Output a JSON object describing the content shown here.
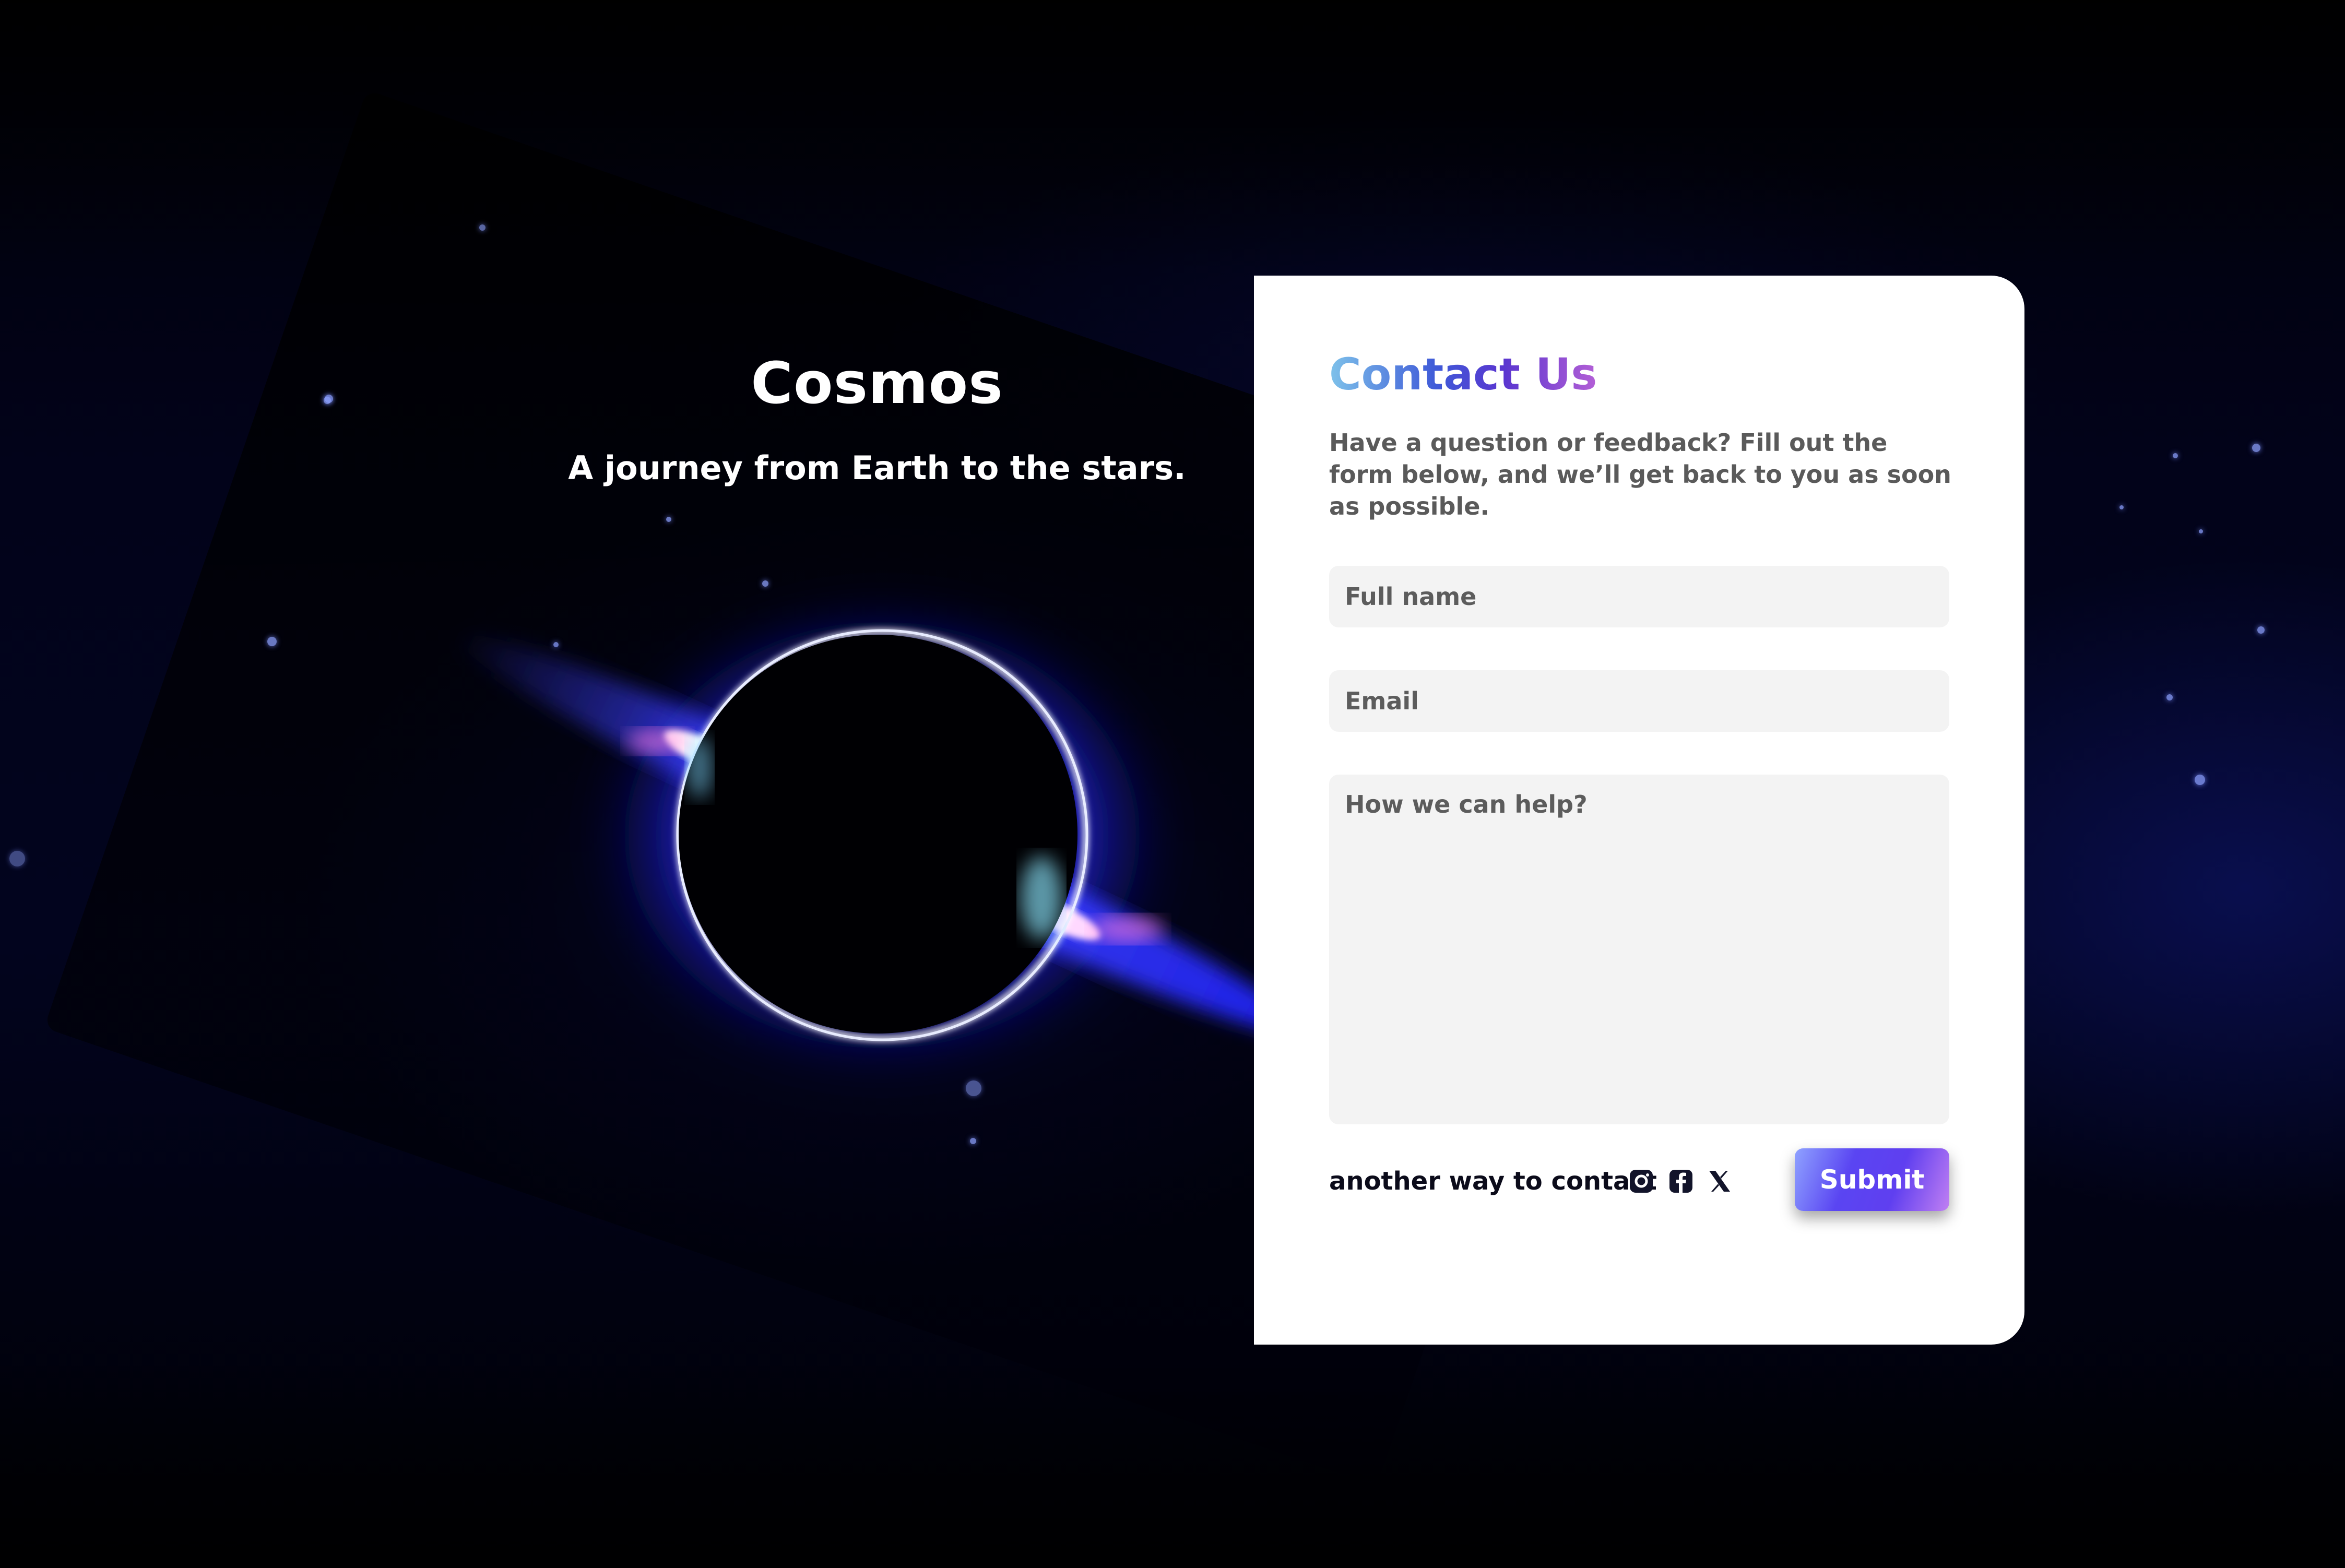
{
  "hero": {
    "title": "Cosmos",
    "subtitle": "A journey from Earth to the stars."
  },
  "contact": {
    "title": "Contact Us",
    "description": "Have a question or feedback? Fill out the form below, and we’ll get back to you as soon as possible.",
    "fields": {
      "name_placeholder": "Full name",
      "email_placeholder": "Email",
      "message_placeholder": "How we can help?"
    },
    "alt_contact_label": "another way to contact",
    "social_icons": [
      "instagram-icon",
      "facebook-icon",
      "x-icon"
    ],
    "submit_label": "Submit"
  },
  "colors": {
    "card_background": "#ffffff",
    "field_background": "#f3f3f3",
    "title_gradient": [
      "#7ec2ea",
      "#3f5ad8",
      "#5a36d0",
      "#b35fd6"
    ],
    "button_gradient": [
      "#8fa2ff",
      "#5a45f2",
      "#c07ff2"
    ],
    "nebula_blue": "#1a22c8"
  }
}
